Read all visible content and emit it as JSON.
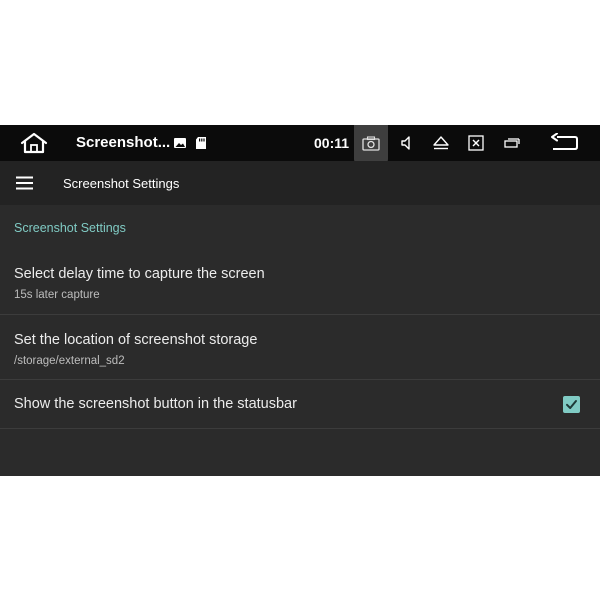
{
  "statusbar": {
    "app_title": "Screenshot...",
    "clock": "00:11",
    "notification_icons": [
      "image-icon",
      "sd-card-icon"
    ],
    "right_icons": [
      "screenshot-icon",
      "volume-icon",
      "eject-icon",
      "close-window-icon",
      "minimize-icon",
      "back-icon"
    ]
  },
  "toolbar": {
    "title": "Screenshot Settings"
  },
  "settings": {
    "category": "Screenshot Settings",
    "items": [
      {
        "title": "Select delay time to capture the screen",
        "summary": "15s later capture"
      },
      {
        "title": "Set the location of screenshot storage",
        "summary": "/storage/external_sd2"
      },
      {
        "title": "Show the screenshot button in the statusbar",
        "checked": true
      }
    ]
  },
  "colors": {
    "statusbar_bg": "#0b0b0b",
    "toolbar_bg": "#232323",
    "content_bg": "#2b2b2b",
    "accent": "#80cbc4"
  }
}
